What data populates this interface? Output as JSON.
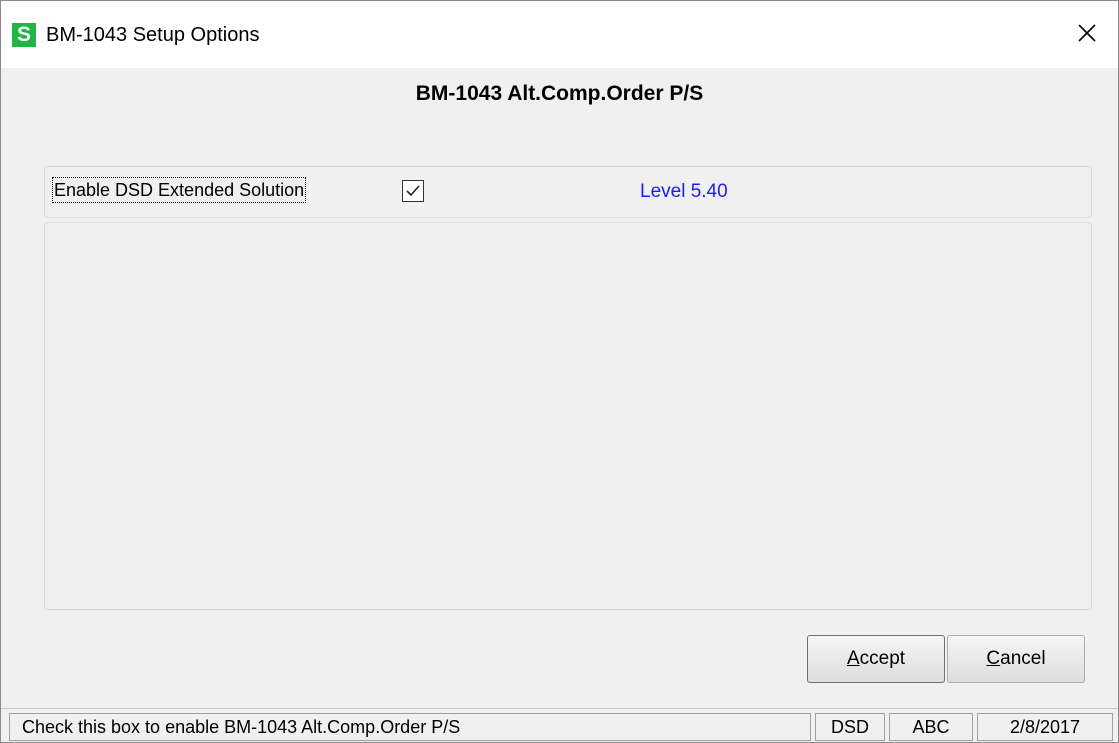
{
  "window": {
    "title": "BM-1043 Setup Options",
    "app_icon_letter": "S",
    "icon_color": "#1fb544"
  },
  "heading": "BM-1043 Alt.Comp.Order P/S",
  "options": {
    "enable_label": "Enable DSD Extended Solution",
    "enable_checked": true,
    "level_text": "Level  5.40",
    "level_color": "#1c1cf0"
  },
  "buttons": {
    "accept_label_underlined": "A",
    "accept_label_rest": "ccept",
    "cancel_label_underlined": "C",
    "cancel_label_rest": "ancel"
  },
  "statusbar": {
    "message": "Check this box to enable BM-1043 Alt.Comp.Order P/S",
    "module": "DSD",
    "company": "ABC",
    "date": "2/8/2017"
  }
}
